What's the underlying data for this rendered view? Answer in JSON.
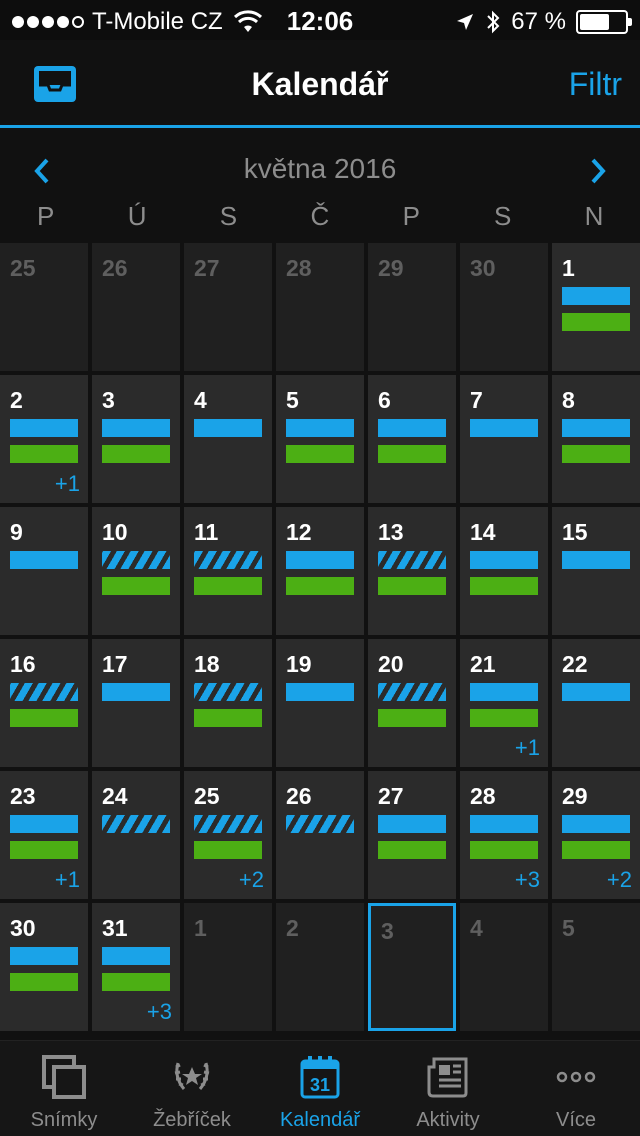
{
  "status_bar": {
    "carrier": "T-Mobile CZ",
    "time": "12:06",
    "battery": "67 %",
    "battery_level": 0.67
  },
  "nav": {
    "title": "Kalendář",
    "filter_label": "Filtr",
    "inbox_icon": "inbox-icon"
  },
  "month": {
    "title": "května 2016",
    "weekdays": [
      "P",
      "Ú",
      "S",
      "Č",
      "P",
      "S",
      "N"
    ]
  },
  "colors": {
    "accent": "#1aa3e8",
    "green": "#4caf14"
  },
  "calendar": {
    "days": [
      {
        "label": "25",
        "outside": true,
        "bars": []
      },
      {
        "label": "26",
        "outside": true,
        "bars": []
      },
      {
        "label": "27",
        "outside": true,
        "bars": []
      },
      {
        "label": "28",
        "outside": true,
        "bars": []
      },
      {
        "label": "29",
        "outside": true,
        "bars": []
      },
      {
        "label": "30",
        "outside": true,
        "bars": []
      },
      {
        "label": "1",
        "outside": false,
        "bars": [
          "blue",
          "green"
        ]
      },
      {
        "label": "2",
        "outside": false,
        "bars": [
          "blue",
          "green"
        ],
        "more": "+1"
      },
      {
        "label": "3",
        "outside": false,
        "bars": [
          "blue",
          "green"
        ]
      },
      {
        "label": "4",
        "outside": false,
        "bars": [
          "blue"
        ]
      },
      {
        "label": "5",
        "outside": false,
        "bars": [
          "blue",
          "green"
        ]
      },
      {
        "label": "6",
        "outside": false,
        "bars": [
          "blue",
          "green"
        ]
      },
      {
        "label": "7",
        "outside": false,
        "bars": [
          "blue"
        ]
      },
      {
        "label": "8",
        "outside": false,
        "bars": [
          "blue",
          "green"
        ]
      },
      {
        "label": "9",
        "outside": false,
        "bars": [
          "blue"
        ]
      },
      {
        "label": "10",
        "outside": false,
        "bars": [
          "hatch",
          "green"
        ]
      },
      {
        "label": "11",
        "outside": false,
        "bars": [
          "hatch",
          "green"
        ]
      },
      {
        "label": "12",
        "outside": false,
        "bars": [
          "blue",
          "green"
        ]
      },
      {
        "label": "13",
        "outside": false,
        "bars": [
          "hatch",
          "green"
        ]
      },
      {
        "label": "14",
        "outside": false,
        "bars": [
          "blue",
          "green"
        ]
      },
      {
        "label": "15",
        "outside": false,
        "bars": [
          "blue"
        ]
      },
      {
        "label": "16",
        "outside": false,
        "bars": [
          "hatch",
          "green"
        ]
      },
      {
        "label": "17",
        "outside": false,
        "bars": [
          "blue"
        ]
      },
      {
        "label": "18",
        "outside": false,
        "bars": [
          "hatch",
          "green"
        ]
      },
      {
        "label": "19",
        "outside": false,
        "bars": [
          "blue"
        ]
      },
      {
        "label": "20",
        "outside": false,
        "bars": [
          "hatch",
          "green"
        ]
      },
      {
        "label": "21",
        "outside": false,
        "bars": [
          "blue",
          "green"
        ],
        "more": "+1"
      },
      {
        "label": "22",
        "outside": false,
        "bars": [
          "blue"
        ]
      },
      {
        "label": "23",
        "outside": false,
        "bars": [
          "blue",
          "green"
        ],
        "more": "+1"
      },
      {
        "label": "24",
        "outside": false,
        "bars": [
          "hatch"
        ]
      },
      {
        "label": "25",
        "outside": false,
        "bars": [
          "hatch",
          "green"
        ],
        "more": "+2"
      },
      {
        "label": "26",
        "outside": false,
        "bars": [
          "hatch"
        ]
      },
      {
        "label": "27",
        "outside": false,
        "bars": [
          "blue",
          "green"
        ]
      },
      {
        "label": "28",
        "outside": false,
        "bars": [
          "blue",
          "green"
        ],
        "more": "+3"
      },
      {
        "label": "29",
        "outside": false,
        "bars": [
          "blue",
          "green"
        ],
        "more": "+2"
      },
      {
        "label": "30",
        "outside": false,
        "bars": [
          "blue",
          "green"
        ]
      },
      {
        "label": "31",
        "outside": false,
        "bars": [
          "blue",
          "green"
        ],
        "more": "+3"
      },
      {
        "label": "1",
        "outside": true,
        "bars": []
      },
      {
        "label": "2",
        "outside": true,
        "bars": []
      },
      {
        "label": "3",
        "outside": true,
        "bars": [],
        "selected": true
      },
      {
        "label": "4",
        "outside": true,
        "bars": []
      },
      {
        "label": "5",
        "outside": true,
        "bars": []
      }
    ]
  },
  "tabs": [
    {
      "label": "Snímky",
      "icon": "snapshots-icon",
      "active": false
    },
    {
      "label": "Žebříček",
      "icon": "leaderboard-icon",
      "active": false
    },
    {
      "label": "Kalendář",
      "icon": "calendar-icon",
      "active": true,
      "icon_text": "31"
    },
    {
      "label": "Aktivity",
      "icon": "activities-icon",
      "active": false
    },
    {
      "label": "Více",
      "icon": "more-icon",
      "active": false
    }
  ]
}
